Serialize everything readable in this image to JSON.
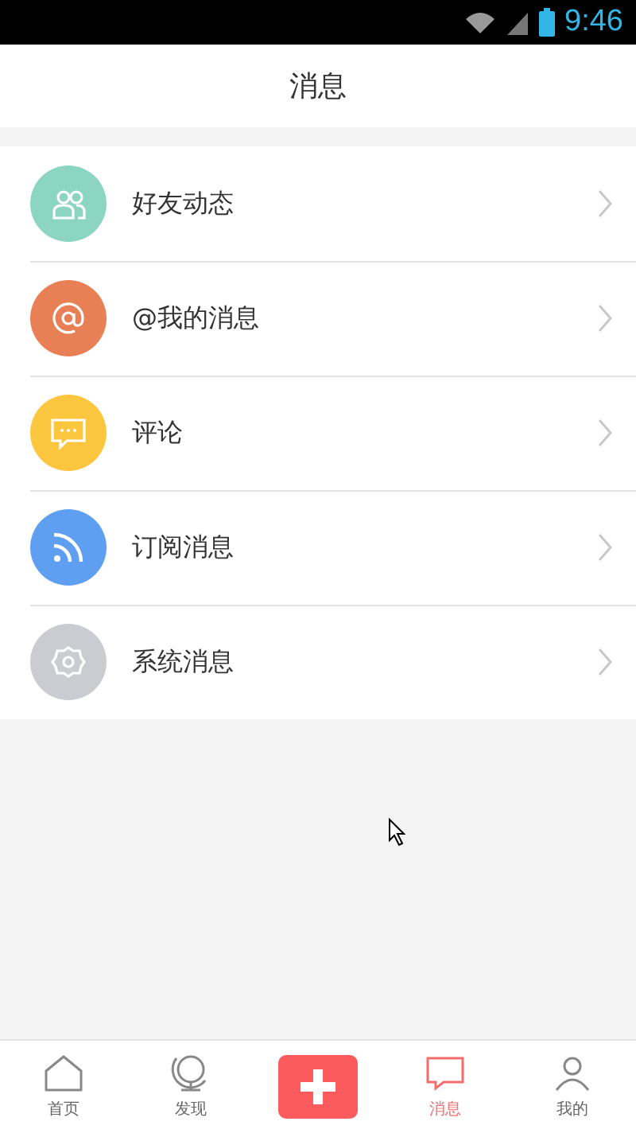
{
  "status_bar": {
    "time": "9:46"
  },
  "header": {
    "title": "消息"
  },
  "items": [
    {
      "label": "好友动态",
      "kind": "people",
      "color": "#8dd5c3"
    },
    {
      "label": "@我的消息",
      "kind": "at",
      "color": "#e98055"
    },
    {
      "label": "评论",
      "kind": "chat",
      "color": "#fcc63e"
    },
    {
      "label": "订阅消息",
      "kind": "rss",
      "color": "#5e9ff2"
    },
    {
      "label": "系统消息",
      "kind": "gear",
      "color": "#c9cdd2"
    }
  ],
  "tabs": [
    {
      "label": "首页",
      "kind": "home",
      "selected": false
    },
    {
      "label": "发现",
      "kind": "globe",
      "selected": false
    },
    {
      "kind": "add",
      "selected": false
    },
    {
      "label": "消息",
      "kind": "message",
      "selected": true
    },
    {
      "label": "我的",
      "kind": "person",
      "selected": false
    }
  ]
}
